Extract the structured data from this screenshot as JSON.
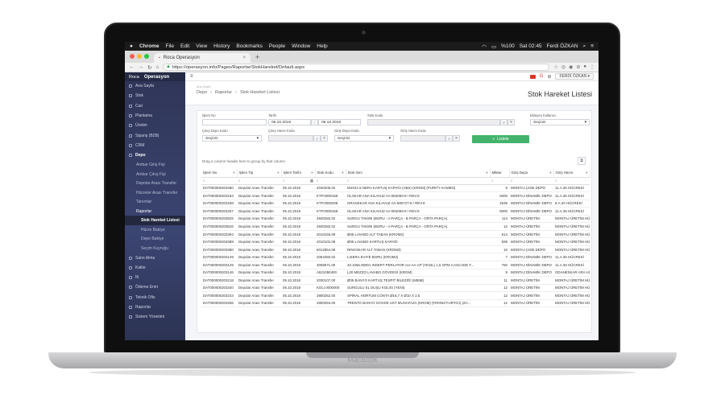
{
  "device": {
    "brand": "MacBook"
  },
  "menubar": {
    "app": "Chrome",
    "items": [
      "File",
      "Edit",
      "View",
      "History",
      "Bookmarks",
      "People",
      "Window",
      "Help"
    ],
    "battery": "%100",
    "clock": "Sat 02:45",
    "user": "Ferdi ÖZKAN"
  },
  "browser": {
    "tab_title": "Roca Operasyon",
    "new_tab": "+",
    "url": "https://operasyon.info/Pages/Raporlar/StokHareket/Default.aspx"
  },
  "sidebar": {
    "brand_short": "Roca",
    "brand": "Operasyon",
    "items": [
      {
        "label": "Ana Sayfa"
      },
      {
        "label": "Stok"
      },
      {
        "label": "Cari"
      },
      {
        "label": "Planlama"
      },
      {
        "label": "Üretim"
      },
      {
        "label": "Sipariş (B2B)"
      },
      {
        "label": "CRM"
      },
      {
        "label": "Depo"
      }
    ],
    "depo_sub": [
      "Ambar Giriş Fişi",
      "Ambar Çıkış Fişi",
      "Depolar Arası Transfer",
      "Hücreler Arası Transfer",
      "Tanımlar",
      "Raporlar"
    ],
    "raporlar_sub": [
      "Stok Hareket Listesi",
      "Hücre Bakiye",
      "Depo Bakiye",
      "Seçim Kuyruğu"
    ],
    "bottom_items": [
      {
        "label": "Satın Alma"
      },
      {
        "label": "Kalite"
      },
      {
        "label": "İK"
      },
      {
        "label": "Ödeme Emri"
      },
      {
        "label": "Teknik Ofis"
      },
      {
        "label": "Raporlar"
      },
      {
        "label": "Sistem Yönetimi"
      }
    ]
  },
  "topnav": {
    "menu_icon": "≡",
    "user_button": "FERDİ ÖZKAN"
  },
  "page": {
    "crumb_top": "Ana Sayfa",
    "crumb": [
      "Depo",
      "Raporlar",
      "Stok Hareket Listesi"
    ],
    "title": "Stok Hareket Listesi"
  },
  "filters": {
    "islem_no_label": "İşlem No",
    "tarih_label": "Tarihi",
    "tarih_from": "05.10.2018",
    "tarih_to": "06.10.2018",
    "stok_kodu_label": "Stok Kodu",
    "ekleyen_label": "Ekleyen Kullanıcı",
    "ekleyen_value": "Seçiniz",
    "cikis_depo_label": "Çıkış Depo Kodu",
    "cikis_depo_value": "Seçiniz",
    "cikis_hucre_label": "Çıkış Hücre Kodu",
    "giris_depo_label": "Giriş Depo Kodu",
    "giris_depo_value": "Seçiniz",
    "giris_hucre_label": "Giriş Hücre Kodu",
    "list_button": "Listele",
    "range_sep": "-"
  },
  "grid": {
    "group_hint": "Drag a column header here to group by that column",
    "columns": [
      "İşlem No",
      "İşlem Tip",
      "İşlem Tarihi",
      "Stok Kodu",
      "Stok İsmi",
      "Miktar",
      "Giriş Depo",
      "Giriş Hücre"
    ],
    "rows": [
      [
        "DAT000000203380",
        "Depolar Arası Transfer",
        "05.10.2018",
        "2040206.02",
        "M4X41.5 NERA KARTUŞ KAPAĞI (ABS) (KROM) (PURITY KAMEN)",
        "5",
        "MONTAJ (ADE DEPO",
        "11.A.35 HÜCRESİ"
      ],
      [
        "DAT000000203184",
        "Depolar Arası Transfer",
        "05.10.2018",
        "KTP.0000168",
        "OLSKAR ANA KILAVUZ AA-804093-9 / REV.9",
        "9200",
        "MONTAJ DİNAMİK DEPO",
        "11.A.35 HÜCRESİ"
      ],
      [
        "DAT000000203188",
        "Depolar Arası Transfer",
        "05.10.2018",
        "KTP.0000208",
        "GRANSKAR ANA KILAVUZ AA-580727-9 / REV.9",
        "2535",
        "MONTAJ DİNAMİK DEPO",
        "8.A.20 HÜCRESİ"
      ],
      [
        "DAT000000203257",
        "Depolar Arası Transfer",
        "05.10.2018",
        "KTP.0000168",
        "OLSKAR ANA KILAVUZ AA-804093-9 / REV.9",
        "5000",
        "MONTAJ DİNAMİK DEPO",
        "11.A.35 HÜCRESİ"
      ],
      [
        "DAT000000203525",
        "Depolar Arası Transfer",
        "05.10.2018",
        "2840282.02",
        "SURGU TAKIMI (BORU - A PARÇA - B PARÇA - ORTA PARÇA)",
        "114",
        "MONTAJ ÜRETİM",
        "MONTAJ ÜRETİM HÜC"
      ],
      [
        "DAT000000203526",
        "Depolar Arası Transfer",
        "05.10.2018",
        "2840282.02",
        "SURGU TAKIMI (BORU - A PARÇA - B PARÇA - ORTA PARÇA)",
        "12",
        "MONTAJ ÜRETİM",
        "MONTAJ ÜRETİM HÜC"
      ],
      [
        "DAT000000203394",
        "Depolar Arası Transfer",
        "05.10.2018",
        "2010155.09",
        "Ø35 LAVABO ALT TABAN (KROM2)",
        "614",
        "MONTAJ ÜRETİM",
        "MONTAJ ÜRETİM HÜC"
      ],
      [
        "DAT000000203389",
        "Depolar Arası Transfer",
        "05.10.2018",
        "2010102.09",
        "Ø35 LAVABO KARTUŞ KAPAĞI",
        "838",
        "MONTAJ ÜRETİM",
        "MONTAJ ÜRETİM HÜC"
      ],
      [
        "DAT000000203380",
        "Depolar Arası Transfer",
        "05.10.2018",
        "6012854.09",
        "RINGSKAR ALT TABAN (KROM3)",
        "10",
        "MONTAJ (ADE DEPO",
        "MONTAJ ÜRETİM HÜC"
      ],
      [
        "DAT000000203149",
        "Depolar Arası Transfer",
        "05.10.2018",
        "2063450.02",
        "LISERA EVIYE BORU (KROM3)",
        "7",
        "MONTAJ DİNAMİK DEPO",
        "11.A.35 HÜCRESİ"
      ],
      [
        "DAT000000203129",
        "Depolar Arası Transfer",
        "05.10.2018",
        "3008571.00",
        "40.1056.00001 INSERT PERLATOR AU-AA-AP (YESIL) 1,5 GPM CASCADE F...",
        "750",
        "MONTAJ DİNAMİK DEPO",
        "11.A.35 HÜCRESİ"
      ],
      [
        "DAT000000203146",
        "Depolar Arası Transfer",
        "05.10.2018",
        "A521050400",
        "L20 MEZZO LAVABO GÖVDESİ (KROM)",
        "8",
        "MONTAJ DİNAMİK DEPO",
        "ODANESKAR ARA HÜCR"
      ],
      [
        "DAT000000203218",
        "Depolar Arası Transfer",
        "05.10.2018",
        "2030107.00",
        "Ø35 BANYO KARTUŞ TESPİT BİLEZİĞİ (M55B)",
        "11",
        "MONTAJ ÜRETİM",
        "MONTAJ ÜRETİM HÜC"
      ],
      [
        "DAT000000203340",
        "Depolar Arası Transfer",
        "05.10.2018",
        "KOLI.0000000",
        "SURGULU EL DUŞU KOLISI (YENI)",
        "12",
        "MONTAJ ÜRETİM",
        "MONTAJ ÜRETİM HÜC"
      ],
      [
        "DAT000000203243",
        "Depolar Arası Transfer",
        "05.10.2018",
        "2800252.00",
        "SPİRAL HORTUM CONTA Ø18,7 X Ø10 X 2,5",
        "12",
        "MONTAJ ÜRETİM",
        "MONTAJ ÜRETİM HÜC"
      ],
      [
        "DAT000000203266",
        "Depolar Arası Transfer",
        "05.10.2018",
        "2800253.00",
        "TRENTO BANYO GOVDE UST MUHAFAZA (KROM) (FIRING/YURTICI) (ZA...",
        "12",
        "MONTAJ ÜRETİM",
        "MONTAJ ÜRETİM HÜC"
      ]
    ]
  },
  "colors": {
    "accent_green": "#43b36b",
    "sidebar": "#3b4572"
  }
}
